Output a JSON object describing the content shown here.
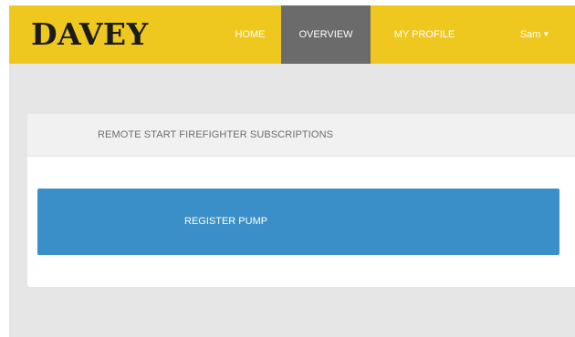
{
  "header": {
    "brand": "DAVEY",
    "nav": {
      "home": "HOME",
      "overview": "OVERVIEW",
      "my_profile": "MY PROFILE",
      "user": "Sam"
    },
    "active_nav": "overview",
    "user_caret_icon": "caret-down-icon"
  },
  "main": {
    "panel_title": "REMOTE START FIREFIGHTER SUBSCRIPTIONS",
    "register_button_label": "REGISTER PUMP"
  },
  "colors": {
    "navbar_bg": "#efc81f",
    "active_nav_bg": "#6b6b6b",
    "content_bg": "#e6e6e6",
    "button_blue": "#3b8fc8"
  }
}
